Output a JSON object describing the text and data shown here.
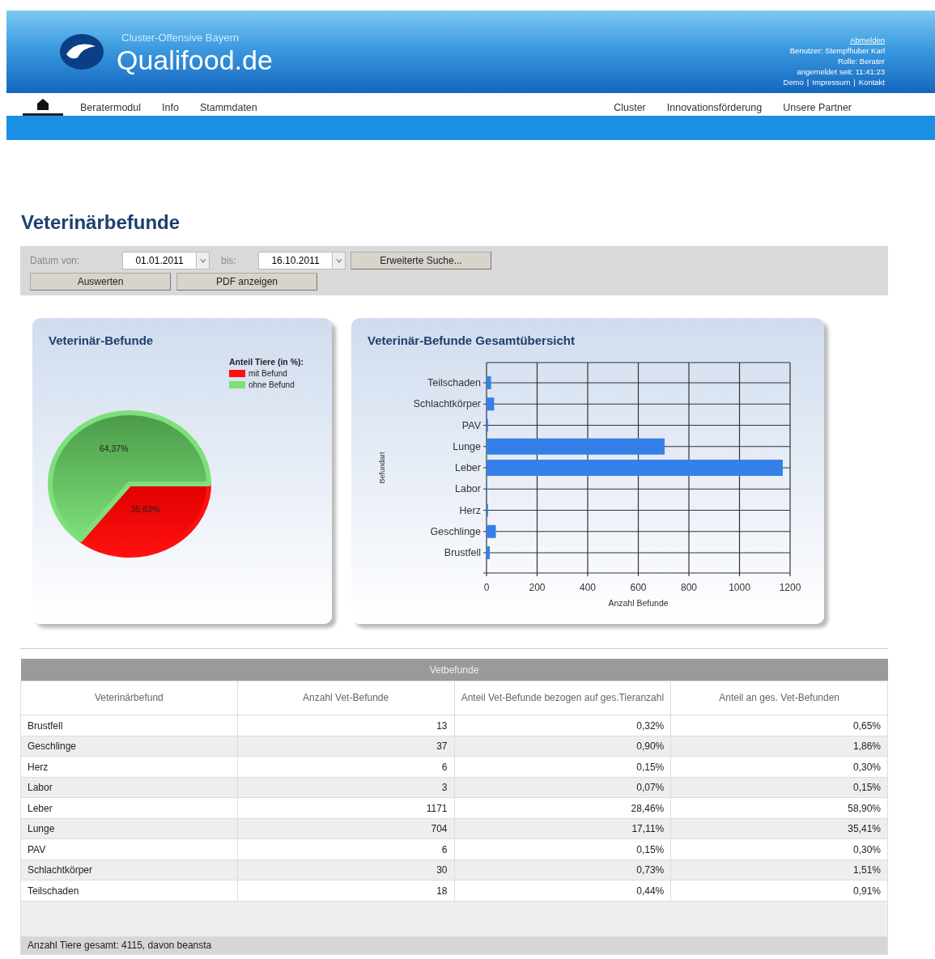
{
  "header": {
    "subtitle": "Cluster-Offensive Bayern",
    "logo_text": "Qualifood.de",
    "logout": "Abmelden",
    "user_lines": [
      "Benutzer: Stempfhuber Karl",
      "Rolle: Berater",
      "angemeldet seit: 11:41:23"
    ],
    "footer_links": [
      "Demo",
      "Impressum",
      "Kontakt"
    ],
    "separator": "|"
  },
  "nav": {
    "home": {
      "selected": true
    },
    "left": [
      {
        "label": "Beratermodul",
        "selected": false
      },
      {
        "label": "Info",
        "selected": false
      },
      {
        "label": "Stammdaten",
        "selected": false
      }
    ],
    "right": [
      {
        "label": "Cluster",
        "selected": false
      },
      {
        "label": "Innovationsförderung",
        "selected": false
      },
      {
        "label": "Unsere Partner",
        "selected": false
      }
    ]
  },
  "page_title": "Veterinärbefunde",
  "filter": {
    "from_label": "Datum von:",
    "from_value": "01.01.2011",
    "to_label": "bis:",
    "to_value": "16.10.2011",
    "buttons": [
      "Erweiterte Suche...",
      "Auswerten",
      "PDF anzeigen"
    ]
  },
  "pie_card": {
    "chart_data": {
      "type": "pie",
      "title": "Veterinär-Befunde",
      "categories": [
        "mit Befund",
        "ohne Befund"
      ],
      "values": [
        35.63,
        64.37
      ],
      "colors": [
        "#ff1010",
        "#7ee07a"
      ],
      "value_labels": [
        "35,63%",
        "64,37%"
      ],
      "legend": {
        "title": "Anteil Tiere (in %):"
      }
    }
  },
  "bar_card": {
    "chart_data": {
      "type": "bar",
      "orientation": "horizontal",
      "title": "Veterinär-Befunde Gesamtübersicht",
      "xlabel": "Anzahl Befunde",
      "ylabel": "Befundart",
      "categories": [
        "Teilschaden",
        "Schlachtkörper",
        "PAV",
        "Lunge",
        "Leber",
        "Labor",
        "Herz",
        "Geschlinge",
        "Brustfell"
      ],
      "series": [
        {
          "color": "#3580e8",
          "values": [
            18,
            30,
            6,
            704,
            1171,
            3,
            6,
            37,
            13
          ]
        }
      ],
      "xlim": [
        0,
        1200
      ],
      "xticks": [
        0,
        200,
        400,
        600,
        800,
        1000,
        1200
      ],
      "grid": true
    }
  },
  "table": {
    "title": "Vetbefunde",
    "columns": [
      "Veterinärbefund",
      "Anzahl Vet-Befunde",
      "Anteil Vet-Befunde bezogen auf ges.Tieranzahl",
      "Anteil an ges. Vet-Befunden"
    ],
    "rows": [
      [
        "Brustfell",
        "13",
        "0,32%",
        "0,65%"
      ],
      [
        "Geschlinge",
        "37",
        "0,90%",
        "1,86%"
      ],
      [
        "Herz",
        "6",
        "0,15%",
        "0,30%"
      ],
      [
        "Labor",
        "3",
        "0,07%",
        "0,15%"
      ],
      [
        "Leber",
        "1171",
        "28,46%",
        "58,90%"
      ],
      [
        "Lunge",
        "704",
        "17,11%",
        "35,41%"
      ],
      [
        "PAV",
        "6",
        "0,15%",
        "0,30%"
      ],
      [
        "Schlachtkörper",
        "30",
        "0,73%",
        "1,51%"
      ],
      [
        "Teilschaden",
        "18",
        "0,44%",
        "0,91%"
      ]
    ],
    "footer": "Anzahl Tiere gesamt: 4115, davon beansta"
  }
}
